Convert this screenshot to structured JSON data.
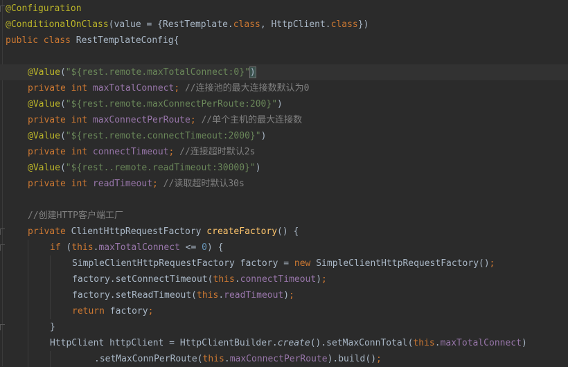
{
  "lines": [
    [
      [
        "ann",
        "@Configuration"
      ]
    ],
    [
      [
        "ann",
        "@ConditionalOnClass"
      ],
      [
        "p",
        "(value = {RestTemplate."
      ],
      [
        "kw",
        "class"
      ],
      [
        "p",
        ", HttpClient."
      ],
      [
        "kw",
        "class"
      ],
      [
        "p",
        "})"
      ]
    ],
    [
      [
        "kw",
        "public class "
      ],
      [
        "p",
        "RestTemplateConfig{"
      ]
    ],
    [],
    [
      [
        "ann",
        "@Value"
      ],
      [
        "p",
        "("
      ],
      [
        "str",
        "\"${rest.remote.maxTotalConnect:0}\""
      ],
      [
        "p",
        ")"
      ]
    ],
    [
      [
        "kw",
        "private int "
      ],
      [
        "fld",
        "maxTotalConnect"
      ],
      [
        "kw",
        "; "
      ],
      [
        "cmt",
        "//连接池的最大连接数默认为0"
      ]
    ],
    [
      [
        "ann",
        "@Value"
      ],
      [
        "p",
        "("
      ],
      [
        "str",
        "\"${rest.remote.maxConnectPerRoute:200}\""
      ],
      [
        "p",
        ")"
      ]
    ],
    [
      [
        "kw",
        "private int "
      ],
      [
        "fld",
        "maxConnectPerRoute"
      ],
      [
        "kw",
        "; "
      ],
      [
        "cmt",
        "//单个主机的最大连接数"
      ]
    ],
    [
      [
        "ann",
        "@Value"
      ],
      [
        "p",
        "("
      ],
      [
        "str",
        "\"${rest.remote.connectTimeout:2000}\""
      ],
      [
        "p",
        ")"
      ]
    ],
    [
      [
        "kw",
        "private int "
      ],
      [
        "fld",
        "connectTimeout"
      ],
      [
        "kw",
        "; "
      ],
      [
        "cmt",
        "//连接超时默认2s"
      ]
    ],
    [
      [
        "ann",
        "@Value"
      ],
      [
        "p",
        "("
      ],
      [
        "str",
        "\"${rest..remote.readTimeout:30000}\""
      ],
      [
        "p",
        ")"
      ]
    ],
    [
      [
        "kw",
        "private int "
      ],
      [
        "fld",
        "readTimeout"
      ],
      [
        "kw",
        "; "
      ],
      [
        "cmt",
        "//读取超时默认30s"
      ]
    ],
    [],
    [
      [
        "cmt",
        "//创建HTTP客户端工厂"
      ]
    ],
    [
      [
        "kw",
        "private "
      ],
      [
        "p",
        "ClientHttpRequestFactory "
      ],
      [
        "fn",
        "createFactory"
      ],
      [
        "p",
        "() {"
      ]
    ],
    [
      [
        "kw",
        "if "
      ],
      [
        "p",
        "("
      ],
      [
        "kw",
        "this"
      ],
      [
        "p",
        "."
      ],
      [
        "fld",
        "maxTotalConnect"
      ],
      [
        "p",
        " <= "
      ],
      [
        "num",
        "0"
      ],
      [
        "p",
        ") {"
      ]
    ],
    [
      [
        "p",
        "SimpleClientHttpRequestFactory factory = "
      ],
      [
        "kw",
        "new "
      ],
      [
        "p",
        "SimpleClientHttpRequestFactory()"
      ],
      [
        "kw",
        ";"
      ]
    ],
    [
      [
        "p",
        "factory.setConnectTimeout("
      ],
      [
        "kw",
        "this"
      ],
      [
        "p",
        "."
      ],
      [
        "fld",
        "connectTimeout"
      ],
      [
        "p",
        ")"
      ],
      [
        "kw",
        ";"
      ]
    ],
    [
      [
        "p",
        "factory.setReadTimeout("
      ],
      [
        "kw",
        "this"
      ],
      [
        "p",
        "."
      ],
      [
        "fld",
        "readTimeout"
      ],
      [
        "p",
        ")"
      ],
      [
        "kw",
        ";"
      ]
    ],
    [
      [
        "kw",
        "return "
      ],
      [
        "p",
        "factory"
      ],
      [
        "kw",
        ";"
      ]
    ],
    [
      [
        "p",
        "}"
      ]
    ],
    [
      [
        "p",
        "HttpClient httpClient = HttpClientBuilder."
      ],
      [
        "it",
        "create"
      ],
      [
        "p",
        "().setMaxConnTotal("
      ],
      [
        "kw",
        "this"
      ],
      [
        "p",
        "."
      ],
      [
        "fld",
        "maxTotalConnect"
      ],
      [
        "p",
        ")"
      ]
    ],
    [
      [
        "p",
        ".setMaxConnPerRoute("
      ],
      [
        "kw",
        "this"
      ],
      [
        "p",
        "."
      ],
      [
        "fld",
        "maxConnectPerRoute"
      ],
      [
        "p",
        ").build()"
      ],
      [
        "kw",
        ";"
      ]
    ]
  ]
}
